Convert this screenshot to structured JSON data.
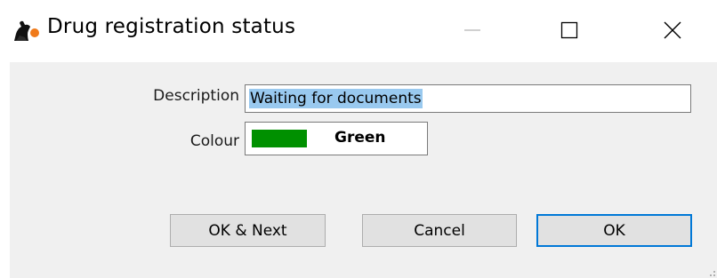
{
  "window": {
    "title": "Drug registration status",
    "icons": {
      "app": "mSupply-app-icon",
      "minimize": "minimize-icon",
      "maximize": "maximize-icon",
      "close": "close-icon"
    }
  },
  "form": {
    "description_label": "Description",
    "description_value": "Waiting for documents",
    "colour_label": "Colour",
    "colour_name": "Green",
    "colour_hex": "#009000"
  },
  "buttons": {
    "ok_next": "OK & Next",
    "cancel": "Cancel",
    "ok": "OK"
  },
  "colors": {
    "selection_highlight": "#99c9ef",
    "default_button_border": "#0078d7",
    "dialog_background": "#f0f0f0"
  }
}
